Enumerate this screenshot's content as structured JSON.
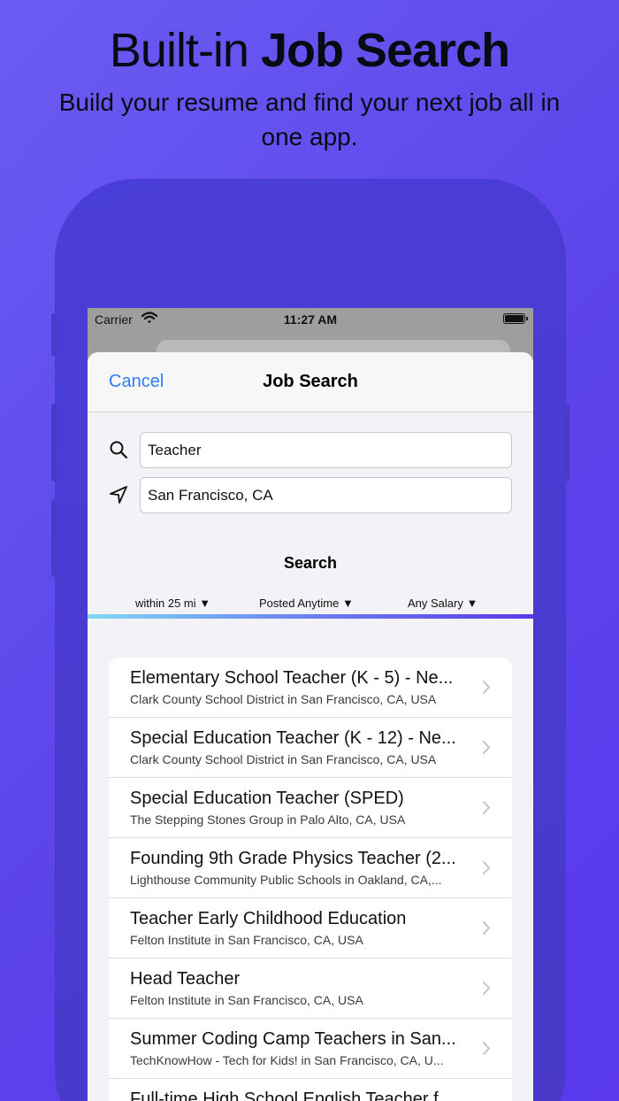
{
  "promo": {
    "title_light": "Built-in",
    "title_bold": "Job Search",
    "subtitle": "Build your resume and find your next job all in one app."
  },
  "status_bar": {
    "carrier": "Carrier",
    "time": "11:27 AM"
  },
  "nav": {
    "cancel_label": "Cancel",
    "title": "Job Search"
  },
  "search_form": {
    "keyword_value": "Teacher",
    "location_value": "San Francisco, CA",
    "search_label": "Search",
    "filters": {
      "distance": "within 25 mi ▼",
      "posted": "Posted Anytime ▼",
      "salary": "Any Salary ▼"
    }
  },
  "results": [
    {
      "title": "Elementary School Teacher (K - 5) - Ne...",
      "subtitle": "Clark County School District in San Francisco, CA, USA"
    },
    {
      "title": "Special Education Teacher (K - 12) - Ne...",
      "subtitle": "Clark County School District in San Francisco, CA, USA"
    },
    {
      "title": "Special Education Teacher (SPED)",
      "subtitle": "The Stepping Stones Group in Palo Alto, CA, USA"
    },
    {
      "title": "Founding 9th Grade Physics Teacher (2...",
      "subtitle": "Lighthouse Community Public Schools in Oakland, CA,..."
    },
    {
      "title": "Teacher Early Childhood Education",
      "subtitle": "Felton Institute in San Francisco, CA, USA"
    },
    {
      "title": "Head Teacher",
      "subtitle": "Felton Institute in San Francisco, CA, USA"
    },
    {
      "title": "Summer Coding Camp Teachers in San...",
      "subtitle": "TechKnowHow - Tech for Kids! in San Francisco, CA, U..."
    },
    {
      "title": "Full-time High School English Teacher f...",
      "subtitle": ""
    }
  ],
  "colors": {
    "accent": "#2f7df6",
    "background_start": "#6a5cf2",
    "background_end": "#5a39ef"
  },
  "icons": {
    "keyword": "search-icon",
    "location": "location-arrow-icon",
    "row": "chevron-right-icon"
  }
}
